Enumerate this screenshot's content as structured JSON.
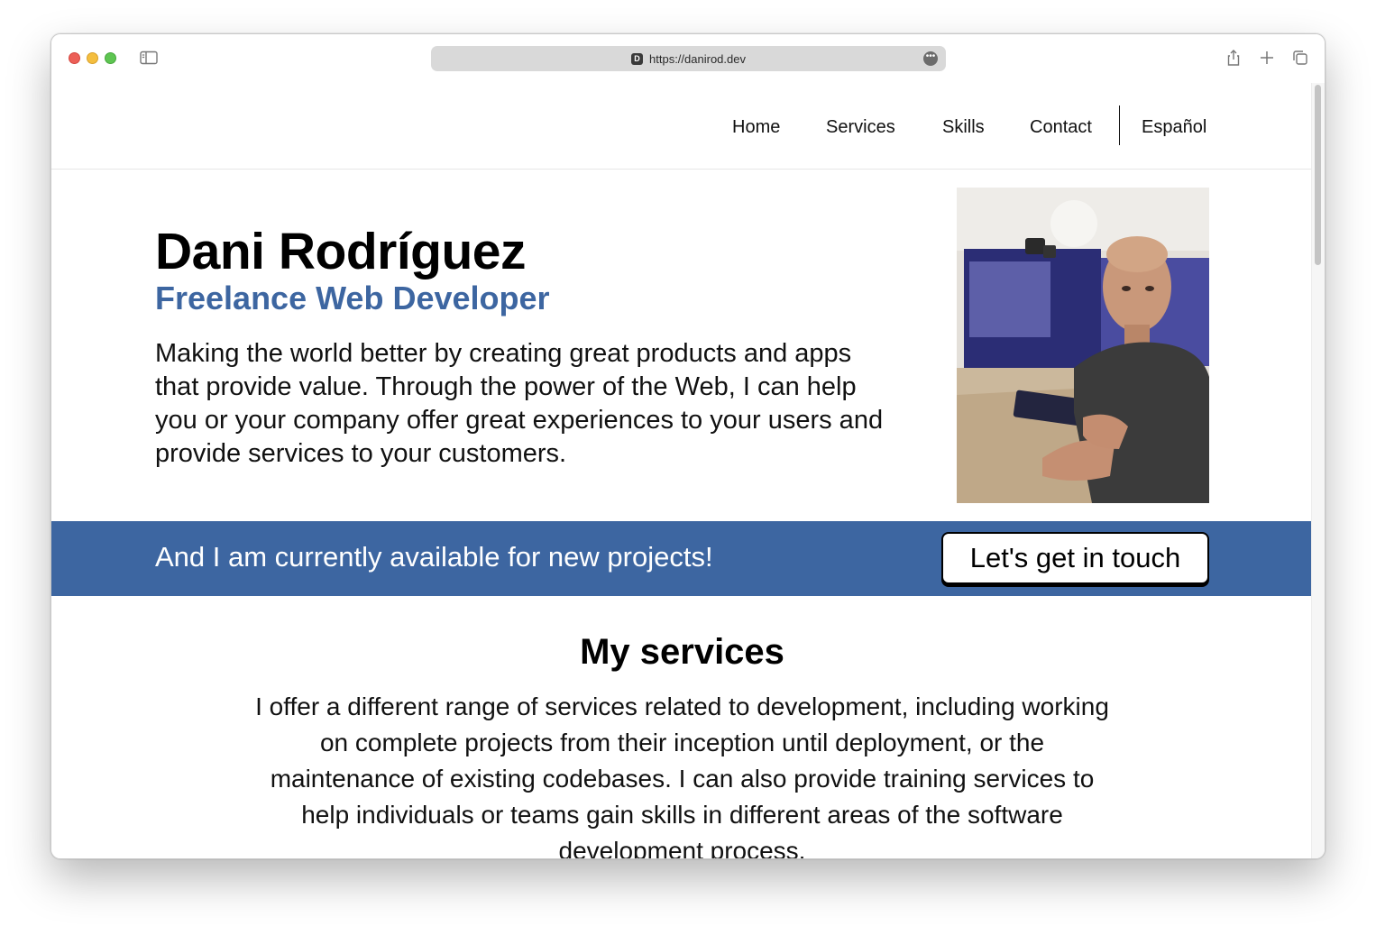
{
  "browser": {
    "url": "https://danirod.dev",
    "favicon_letter": "D",
    "more_glyph": "•••"
  },
  "nav": {
    "items": [
      "Home",
      "Services",
      "Skills",
      "Contact"
    ],
    "language": "Español"
  },
  "hero": {
    "name": "Dani Rodríguez",
    "role": "Freelance Web Developer",
    "description": "Making the world better by creating great products and apps that provide value. Through the power of the Web, I can help you or your company offer great experiences to your users and provide services to your customers."
  },
  "cta": {
    "text": "And I am currently available for new projects!",
    "button": "Let's get in touch"
  },
  "services": {
    "title": "My services",
    "text": "I offer a different range of services related to development, including working on complete projects from their inception until deployment, or the maintenance of existing codebases. I can also provide training services to help individuals or teams gain skills in different areas of the software development process."
  },
  "colors": {
    "accent": "#3d66a1",
    "text": "#111111"
  }
}
